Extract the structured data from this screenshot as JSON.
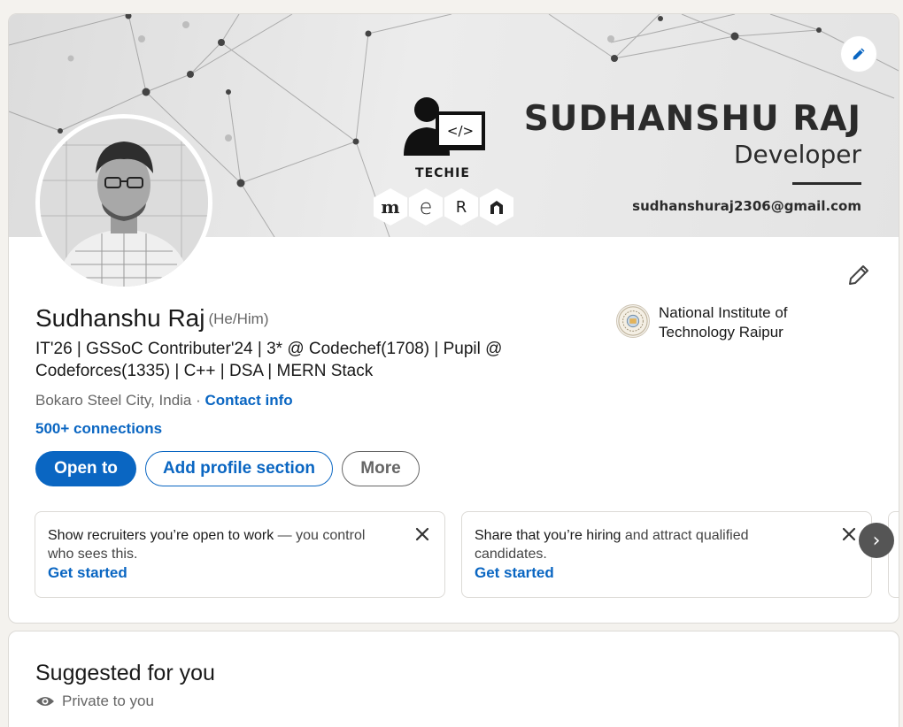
{
  "banner": {
    "name": "SUDHANSHU RAJ",
    "role": "Developer",
    "email": "sudhanshuraj2306@gmail.com",
    "techie_label": "TECHIE",
    "stack_letters": [
      "m",
      "e",
      "R",
      "N"
    ],
    "edit_icon": "pencil-icon"
  },
  "profile": {
    "name": "Sudhanshu Raj",
    "pronouns": "(He/Him)",
    "headline": "IT'26 | GSSoC Contributer'24 | 3* @ Codechef(1708) | Pupil @ Codeforces(1335) | C++ | DSA | MERN Stack",
    "location": "Bokaro Steel City, India",
    "separator": " · ",
    "contact_info": "Contact info",
    "connections": "500+ connections",
    "school": "National Institute of Technology Raipur"
  },
  "actions": {
    "open_to": "Open to",
    "add_section": "Add profile section",
    "more": "More"
  },
  "tips": [
    {
      "lead": "Show recruiters you’re open to work",
      "rest": " — you control who sees this.",
      "link": "Get started"
    },
    {
      "lead": "Share that you’re hiring",
      "rest": " and attract qualified candidates.",
      "link": "Get started"
    }
  ],
  "carousel_next": "›",
  "suggested": {
    "title": "Suggested for you",
    "subtitle": "Private to you"
  },
  "colors": {
    "accent": "#0a66c2",
    "background": "#f4f2ee"
  }
}
